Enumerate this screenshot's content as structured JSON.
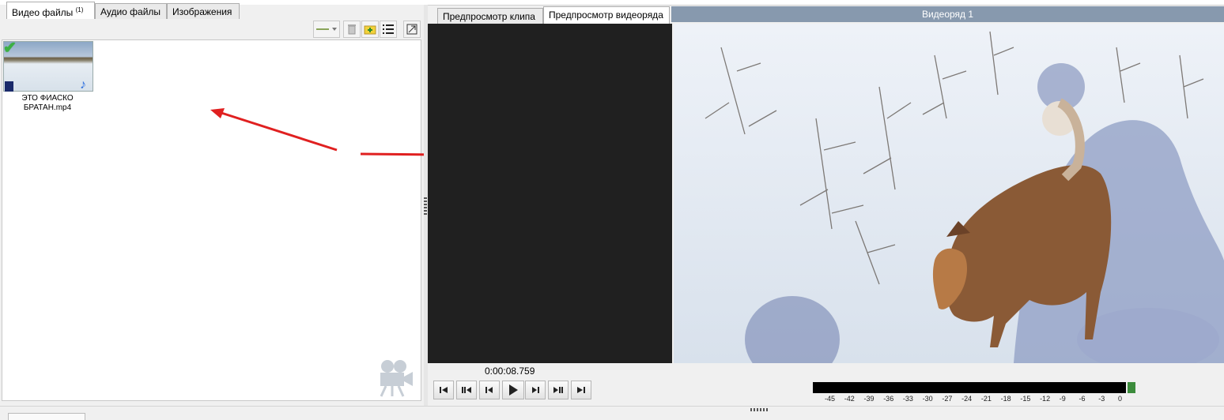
{
  "media_panel": {
    "tabs": [
      {
        "label": "Видео файлы",
        "count": "(1)"
      },
      {
        "label": "Аудио файлы"
      },
      {
        "label": "Изображения"
      }
    ],
    "items": [
      {
        "name_line1": "ЭТО ФИАСКО",
        "name_line2": "БРАТАН.mp4"
      }
    ]
  },
  "preview_panel": {
    "tabs": [
      {
        "label": "Предпросмотр клипа"
      },
      {
        "label": "Предпросмотр видеоряда"
      }
    ],
    "title": "Видеоряд 1",
    "timecode": "0:00:08.759",
    "meter_scale": [
      "-45",
      "-42",
      "-39",
      "-36",
      "-33",
      "-30",
      "-27",
      "-24",
      "-21",
      "-18",
      "-15",
      "-12",
      "-9",
      "-6",
      "-3",
      "0"
    ]
  },
  "colors": {
    "annotation_arrow": "#e02020",
    "title_bar": "#8799ae",
    "meter_level": "#3c8c3c"
  }
}
